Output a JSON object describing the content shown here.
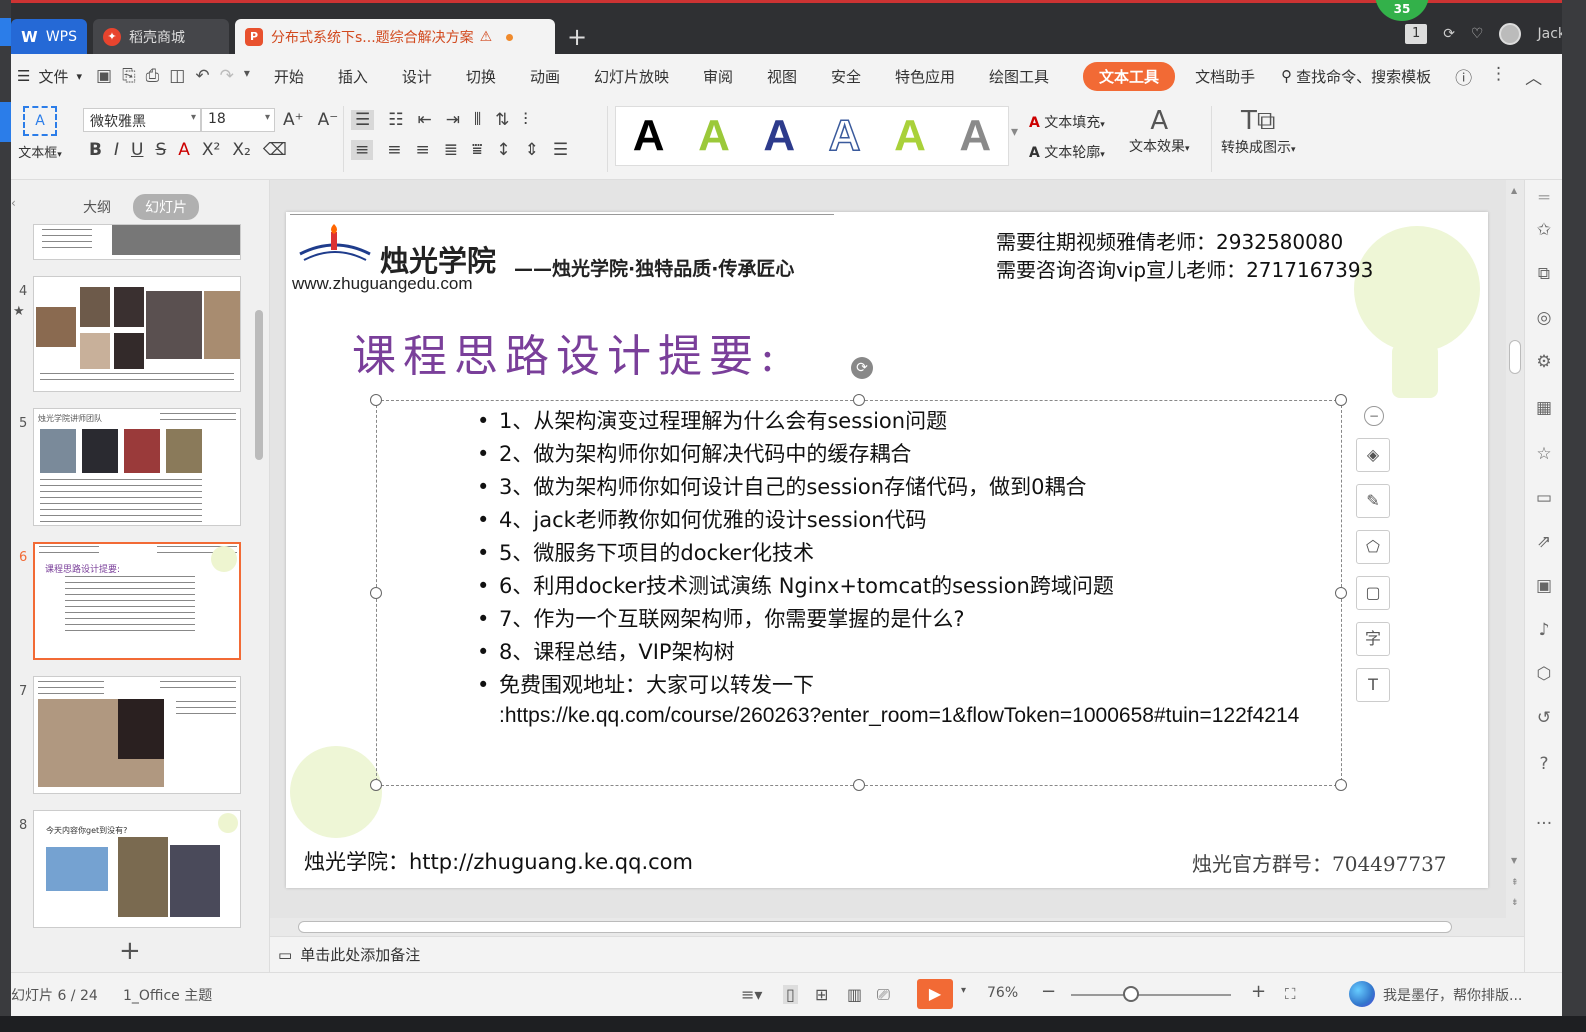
{
  "titlebar": {
    "tabs": [
      {
        "label": "WPS",
        "icon": "wps-logo-icon"
      },
      {
        "label": "稻壳商城",
        "icon": "docer-icon"
      },
      {
        "label": "分布式系统下s...题综合解决方案",
        "icon": "ppt-file-icon"
      }
    ],
    "green_badge": "35",
    "window_count": "1",
    "user_name": "Jack"
  },
  "menubar": {
    "file_label": "文件",
    "items": [
      "开始",
      "插入",
      "设计",
      "切换",
      "动画",
      "幻灯片放映",
      "审阅",
      "视图",
      "安全",
      "特色应用",
      "绘图工具",
      "文本工具",
      "文档助手"
    ],
    "active_item": "文本工具",
    "search_label": "查找命令、搜索模板"
  },
  "ribbon": {
    "textbox_label": "文本框",
    "font_name": "微软雅黑",
    "font_size": "18",
    "wordart_letter": "A",
    "text_fill_label": "文本填充",
    "text_outline_label": "文本轮廓",
    "text_effect_label": "文本效果",
    "convert_label": "转换成图示"
  },
  "panel": {
    "tab_outline": "大纲",
    "tab_slides": "幻灯片",
    "thumbs": [
      {
        "num": "4"
      },
      {
        "num": "5",
        "title": "烛光学院讲师团队"
      },
      {
        "num": "6",
        "title": "课程思路设计提要:"
      },
      {
        "num": "7"
      },
      {
        "num": "8",
        "title": "今天内容你get到没有?"
      }
    ],
    "selected": "6"
  },
  "slide": {
    "logo_name": "烛光学院",
    "slogan": "——烛光学院·独特品质·传承匠心",
    "logo_url": "www.zhuguangedu.com",
    "contact_1": "需要往期视频雅倩老师：2932580080",
    "contact_2": "需要咨询咨询vip宣儿老师：2717167393",
    "title": "课程思路设计提要:",
    "bullets": [
      "1、从架构演变过程理解为什么会有session问题",
      "2、做为架构师你如何解决代码中的缓存耦合",
      "3、做为架构师你如何设计自己的session存储代码，做到0耦合",
      "4、jack老师教你如何优雅的设计session代码",
      "5、微服务下项目的docker化技术",
      "6、利用docker技术测试演练 Nginx+tomcat的session跨域问题",
      "7、作为一个互联网架构师，你需要掌握的是什么?",
      "8、课程总结，VIP架构树"
    ],
    "free_label": "免费围观地址：大家可以转发一下",
    "free_url": ":https://ke.qq.com/course/260263?enter_room=1&flowToken=1000658#tuin=122f4214",
    "footer_left": "烛光学院：http://zhuguang.ke.qq.com",
    "footer_right": "烛光官方群号：704497737"
  },
  "notes": {
    "placeholder": "单击此处添加备注"
  },
  "statusbar": {
    "slide_info": "幻灯片 6 / 24",
    "theme": "1_Office 主题",
    "zoom": "76%",
    "assistant": "我是墨仔，帮你排版..."
  },
  "colors": {
    "accent": "#f26a35",
    "title_purple": "#7a3f9a",
    "wps_blue": "#2569d6"
  }
}
